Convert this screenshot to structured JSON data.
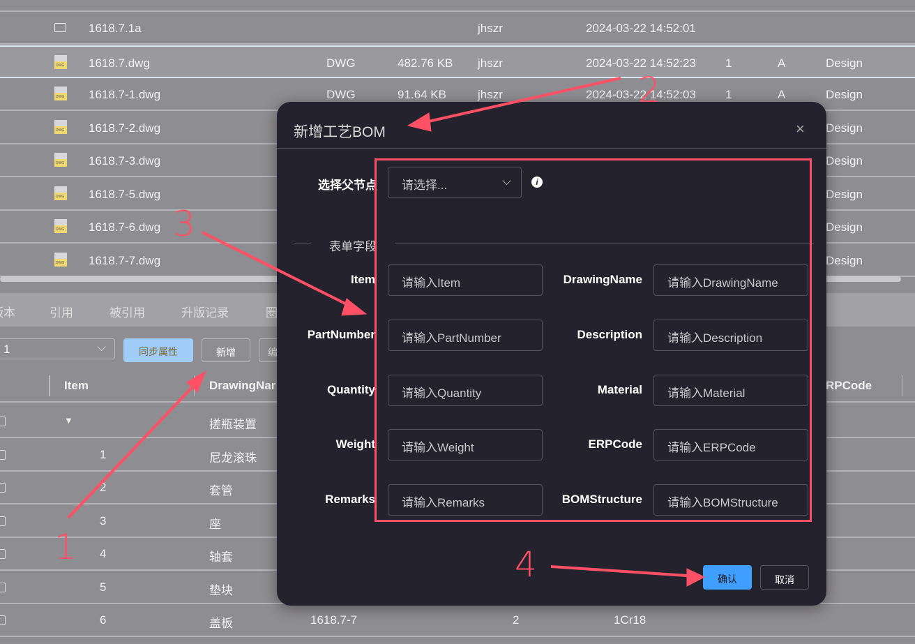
{
  "files": [
    {
      "name": "1618.7.1a",
      "icon": "folder-icon",
      "type": "",
      "size": "",
      "owner": "jhszr",
      "date": "2024-03-22 14:52:01",
      "version": "",
      "revision": "",
      "stage": ""
    },
    {
      "name": "1618.7.dwg",
      "icon": "dwg-file-icon",
      "type": "DWG",
      "size": "482.76 KB",
      "owner": "jhszr",
      "date": "2024-03-22 14:52:23",
      "version": "1",
      "revision": "A",
      "stage": "Design"
    },
    {
      "name": "1618.7-1.dwg",
      "icon": "dwg-file-icon",
      "type": "DWG",
      "size": "91.64 KB",
      "owner": "jhszr",
      "date": "2024-03-22 14:52:03",
      "version": "1",
      "revision": "A",
      "stage": "Design"
    },
    {
      "name": "1618.7-2.dwg",
      "icon": "dwg-file-icon",
      "stage": "Design"
    },
    {
      "name": "1618.7-3.dwg",
      "icon": "dwg-file-icon",
      "stage": "Design"
    },
    {
      "name": "1618.7-5.dwg",
      "icon": "dwg-file-icon",
      "stage": "Design"
    },
    {
      "name": "1618.7-6.dwg",
      "icon": "dwg-file-icon",
      "stage": "Design"
    },
    {
      "name": "1618.7-7.dwg",
      "icon": "dwg-file-icon",
      "stage": "Design"
    }
  ],
  "dwg_icon_text": "DWG",
  "tabs": [
    "版本",
    "引用",
    "被引用",
    "升版记录",
    "圈"
  ],
  "toolbar": {
    "version_select": "1",
    "sync_button": "同步属性",
    "add_button": "新增",
    "third_button": "编"
  },
  "bom_headers": {
    "item": "Item",
    "drawing_name": "DrawingNar",
    "erp_code": "RPCode"
  },
  "bom_rows": [
    {
      "item": "",
      "name": "搓瓶装置",
      "drawing": "",
      "qty": "",
      "material": ""
    },
    {
      "item": "1",
      "name": "尼龙滚珠"
    },
    {
      "item": "2",
      "name": "套管"
    },
    {
      "item": "3",
      "name": "座"
    },
    {
      "item": "4",
      "name": "轴套"
    },
    {
      "item": "5",
      "name": "垫块"
    },
    {
      "item": "6",
      "name": "盖板",
      "drawing": "1618.7-7",
      "qty": "2",
      "material": "1Cr18"
    }
  ],
  "modal": {
    "title": "新增工艺BOM",
    "parent_label": "选择父节点",
    "parent_placeholder": "请选择...",
    "section_label": "表单字段",
    "fields": [
      {
        "label": "Item",
        "placeholder": "请输入Item"
      },
      {
        "label": "DrawingName",
        "placeholder": "请输入DrawingName"
      },
      {
        "label": "PartNumber",
        "placeholder": "请输入PartNumber"
      },
      {
        "label": "Description",
        "placeholder": "请输入Description"
      },
      {
        "label": "Quantity",
        "placeholder": "请输入Quantity"
      },
      {
        "label": "Material",
        "placeholder": "请输入Material"
      },
      {
        "label": "Weight",
        "placeholder": "请输入Weight"
      },
      {
        "label": "ERPCode",
        "placeholder": "请输入ERPCode"
      },
      {
        "label": "Remarks",
        "placeholder": "请输入Remarks"
      },
      {
        "label": "BOMStructure",
        "placeholder": "请输入BOMStructure"
      }
    ],
    "confirm": "确认",
    "cancel": "取消"
  },
  "annotations": [
    "1",
    "2",
    "3",
    "4"
  ],
  "colors": {
    "annotation": "#ff5065",
    "primary": "#409eff",
    "modal_bg": "#23222d"
  }
}
